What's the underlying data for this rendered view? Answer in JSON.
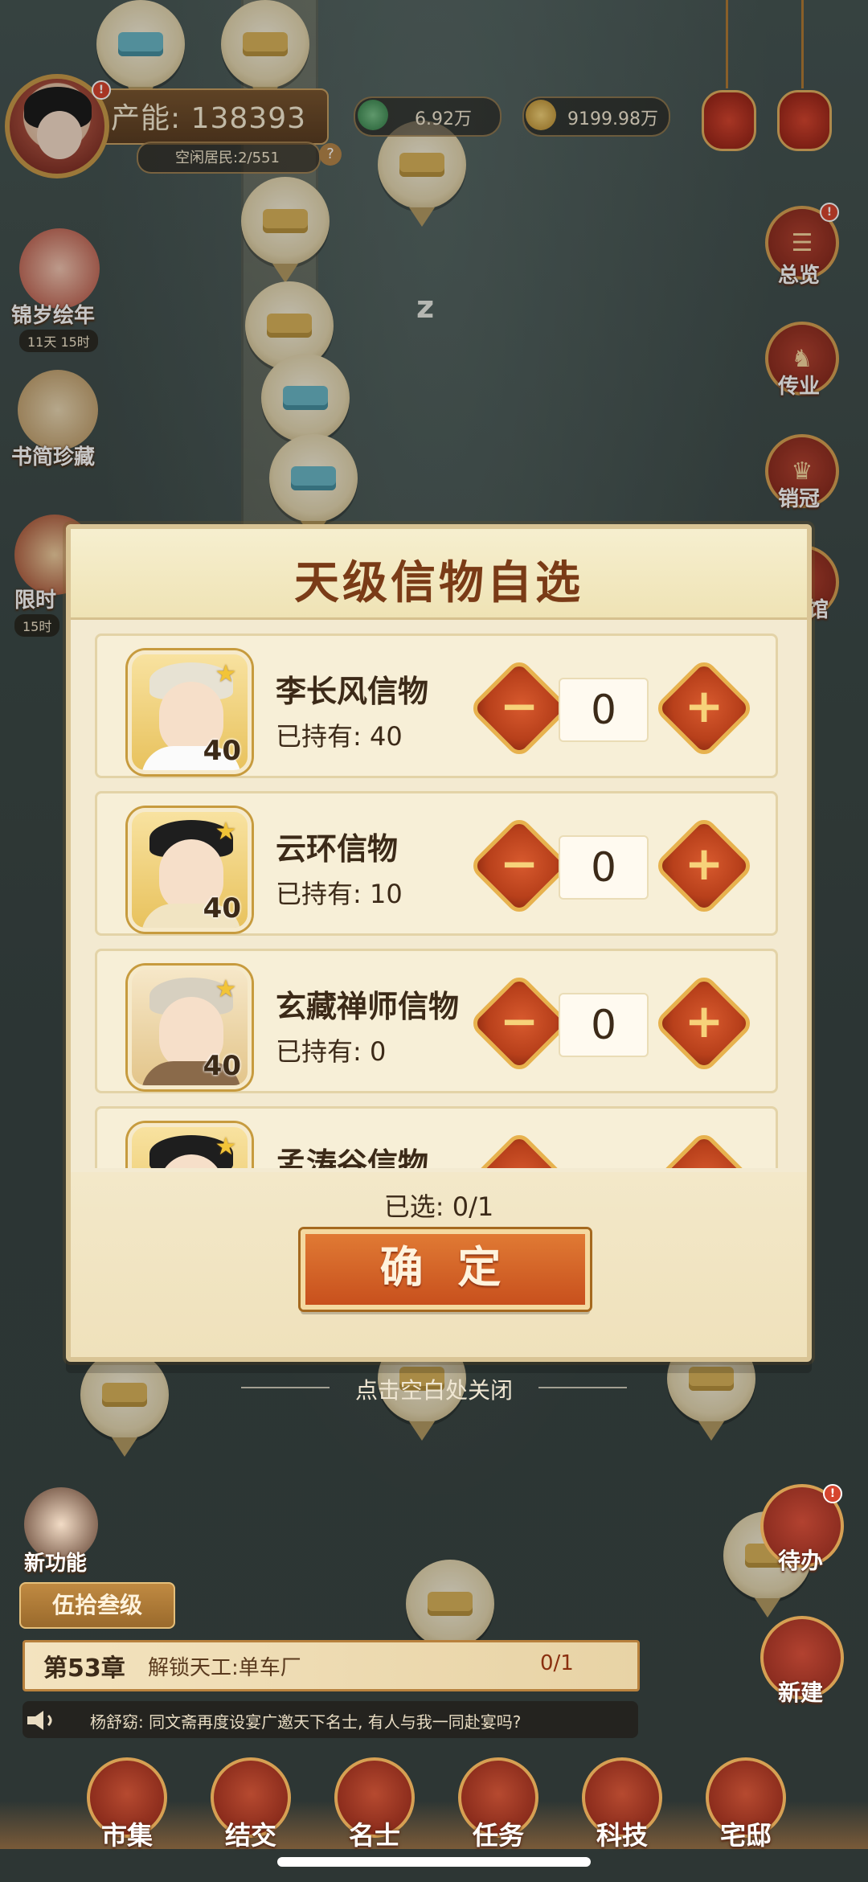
{
  "hud": {
    "capacity_label": "产能: 138393",
    "residents_label": "空闲居民:2/551",
    "jade": "6.92万",
    "gold": "9199.98万"
  },
  "left_events": [
    {
      "label": "锦岁绘年",
      "timer": "11天 15时"
    },
    {
      "label": "书简珍藏"
    },
    {
      "label": "限时",
      "timer": "15时"
    }
  ],
  "right_menu": [
    {
      "label": "总览",
      "badge": "!"
    },
    {
      "label": "传业"
    },
    {
      "label": "销冠"
    },
    {
      "label": "馆"
    }
  ],
  "map_sign": "z",
  "dialog": {
    "title": "天级信物自选",
    "items": [
      {
        "name": "李长风信物",
        "owned": "已持有: 40",
        "level": "40",
        "qty": "0"
      },
      {
        "name": "云环信物",
        "owned": "已持有: 10",
        "level": "40",
        "qty": "0"
      },
      {
        "name": "玄藏禅师信物",
        "owned": "已持有: 0",
        "level": "40",
        "qty": "0"
      },
      {
        "name": "孟涛谷信物",
        "owned": "",
        "level": "",
        "qty": ""
      }
    ],
    "selected": "已选: 0/1",
    "confirm": "确 定",
    "minus_glyph": "−",
    "plus_glyph": "+"
  },
  "close_hint": "点击空白处关闭",
  "bottom_left": {
    "new_feature": "新功能",
    "level_tag": "伍拾叁级",
    "chapter_title": "第53章",
    "chapter_desc": "解锁天工:单车厂",
    "chapter_progress": "0/1",
    "message": "杨舒窈: 同文斋再度设宴广邀天下名士, 有人与我一同赴宴吗?"
  },
  "right_bottom": [
    {
      "label": "待办",
      "badge": "!"
    },
    {
      "label": "新建"
    }
  ],
  "nav": [
    "市集",
    "结交",
    "名士",
    "任务",
    "科技",
    "宅邸"
  ],
  "colors": {
    "dialog_bg": "#f3ead1",
    "title": "#7a3b17",
    "accent_orange": "#c8501d",
    "button_red": "#b8401b",
    "gold_border": "#e7b24e"
  }
}
